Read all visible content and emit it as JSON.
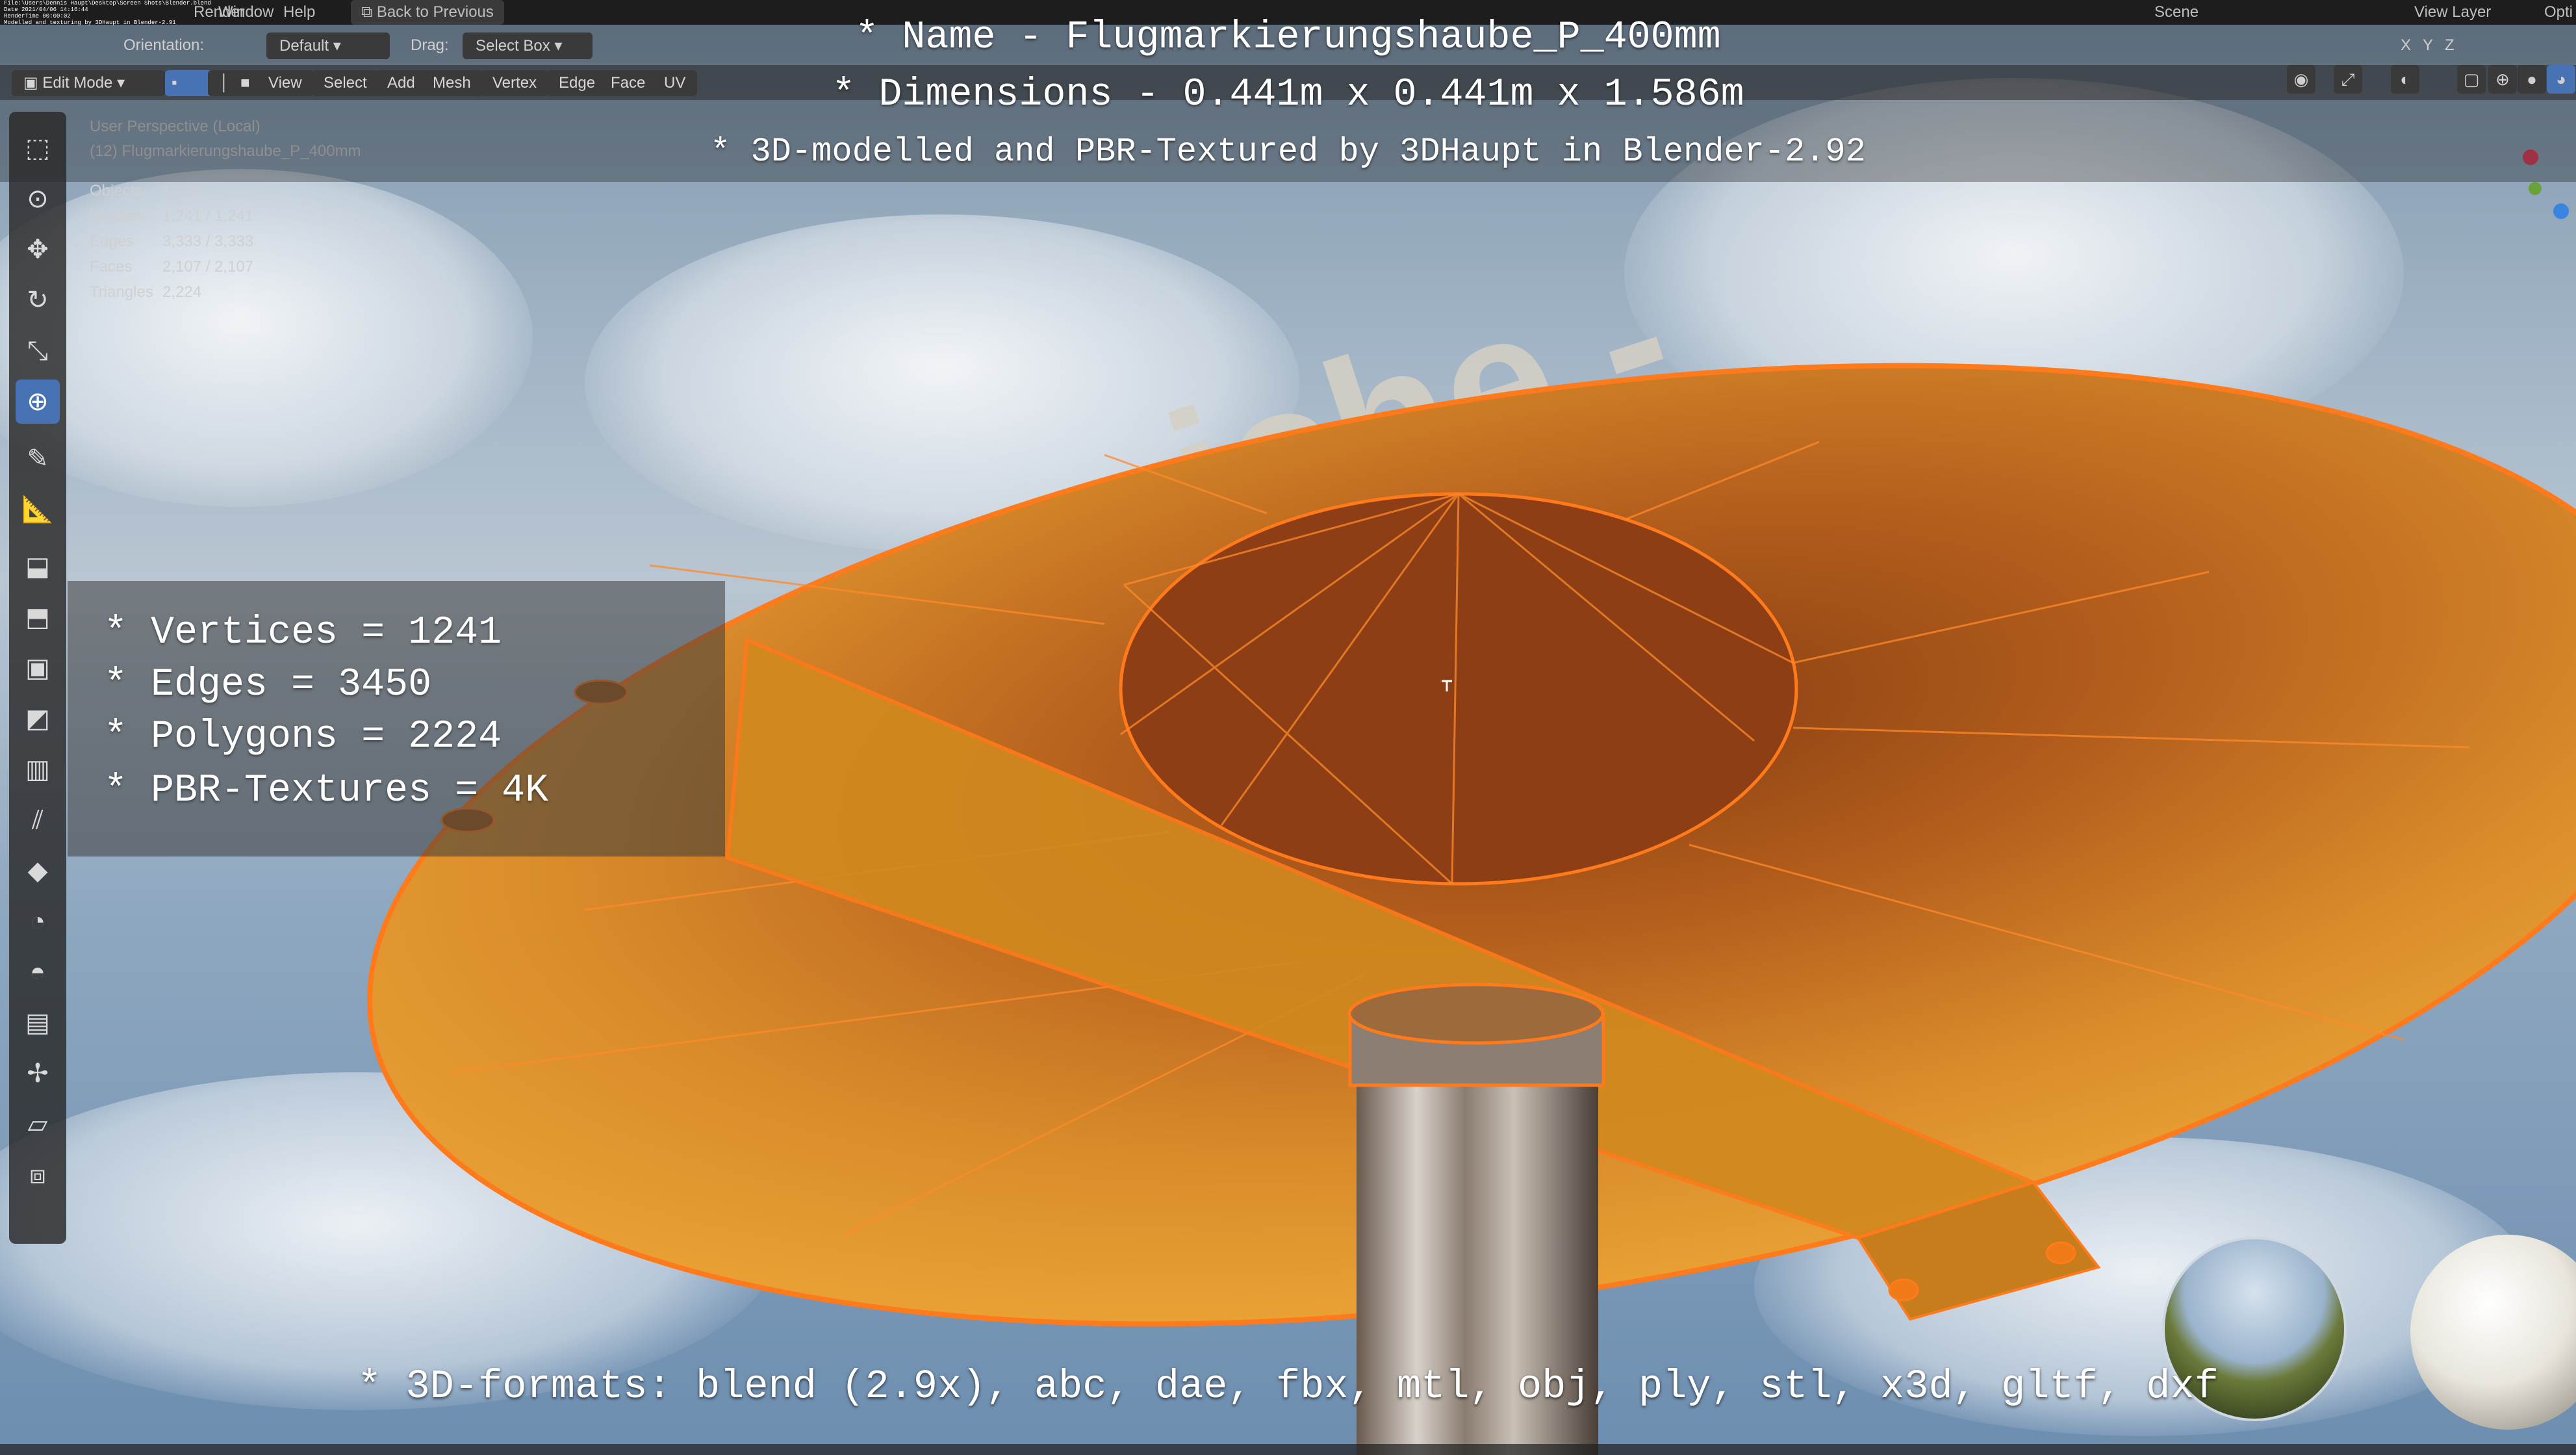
{
  "topbar": {
    "file_path": "File:\\Users\\Dennis Haupt\\Desktop\\Screen Shots\\Blender.blend",
    "date": "Date 2021/04/06 14:16:44",
    "rendertime": "RenderTime 00:00:02",
    "credit": "Modelled and texturing by 3DHaupt in Blender-2.91",
    "menus": [
      "Render",
      "Window",
      "Help"
    ],
    "back_label": "Back to Previous",
    "scene_label": "Scene",
    "view_layer_label": "View Layer",
    "options_label": "Opti"
  },
  "header": {
    "mode_label": "Edit Mode",
    "orientation_label": "Orientation:",
    "orientation_value": "Default",
    "drag_label": "Drag:",
    "drag_value": "Select Box",
    "menus": [
      "View",
      "Select",
      "Add",
      "Mesh",
      "Vertex",
      "Edge",
      "Face",
      "UV"
    ],
    "axes": [
      "X",
      "Y",
      "Z"
    ]
  },
  "viewport_info": {
    "perspective": "User Perspective (Local)",
    "object_name": "(12) Flugmarkierungshaube_P_400mm",
    "stats": [
      {
        "key": "Objects",
        "value": "1 / 24"
      },
      {
        "key": "Vertices",
        "value": "1,241 / 1,241"
      },
      {
        "key": "Edges",
        "value": "3,333 / 3,333"
      },
      {
        "key": "Faces",
        "value": "2,107 / 2,107"
      },
      {
        "key": "Triangles",
        "value": "2,224"
      }
    ]
  },
  "overlay": {
    "name_line": "* Name - Flugmarkierungshaube_P_400mm",
    "dimensions_line": "* Dimensions -  0.441m x 0.441m x 1.586m",
    "credit_line": "* 3D-modelled and PBR-Textured by 3DHaupt in Blender-2.92",
    "stat_lines": [
      "* Vertices = 1241",
      "* Edges = 3450",
      "* Polygons = 2224",
      "* PBR-Textures = 4K"
    ],
    "formats_line": "* 3D-formats: blend (2.9x), abc, dae, fbx, mtl, obj, ply, stl, x3d, gltf, dxf",
    "background_text": "iche -"
  },
  "tools": [
    "select-box-icon",
    "cursor-icon",
    "move-icon",
    "rotate-icon",
    "scale-icon",
    "transform-icon",
    "annotate-icon",
    "measure-icon",
    "add-cube-icon",
    "extrude-icon",
    "inset-icon",
    "bevel-icon",
    "loop-cut-icon",
    "knife-icon",
    "poly-build-icon",
    "spin-icon",
    "smooth-icon",
    "edge-slide-icon",
    "shrink-fatten-icon",
    "shear-icon",
    "rip-region-icon"
  ],
  "colors": {
    "mesh_orange": "#e8a02a",
    "wire_orange": "#ff7a1a",
    "active_tool": "#4772b3"
  }
}
